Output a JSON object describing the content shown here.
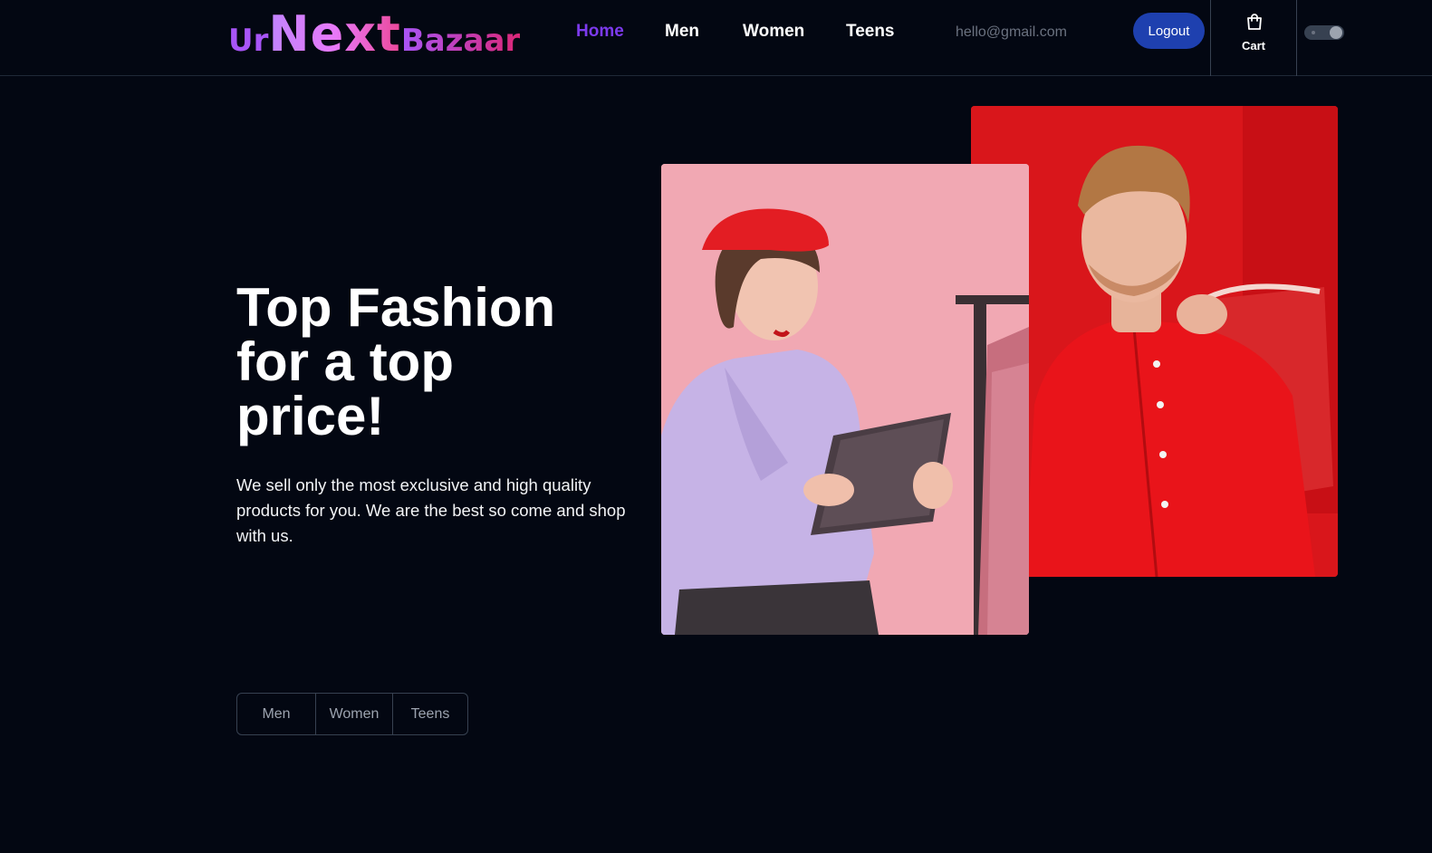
{
  "logo": {
    "part1": "Ur",
    "part2": "Next",
    "part3": "Bazaar"
  },
  "nav": {
    "items": [
      {
        "label": "Home",
        "active": true
      },
      {
        "label": "Men",
        "active": false
      },
      {
        "label": "Women",
        "active": false
      },
      {
        "label": "Teens",
        "active": false
      }
    ],
    "email": "hello@gmail.com",
    "logout_label": "Logout",
    "cart_label": "Cart",
    "theme_toggle": "dark"
  },
  "hero": {
    "title": "Top Fashion for a top price!",
    "description": "We sell only the most exclusive and high quality products for you. We are the best so come and shop with us."
  },
  "filters": {
    "items": [
      "Men",
      "Women",
      "Teens"
    ]
  },
  "colors": {
    "background": "#030712",
    "active_nav": "#7c3aed",
    "logout_button": "#1e40af",
    "border": "#374151"
  },
  "icons": {
    "cart": "shopping-bag-icon",
    "theme": "toggle-icon"
  }
}
